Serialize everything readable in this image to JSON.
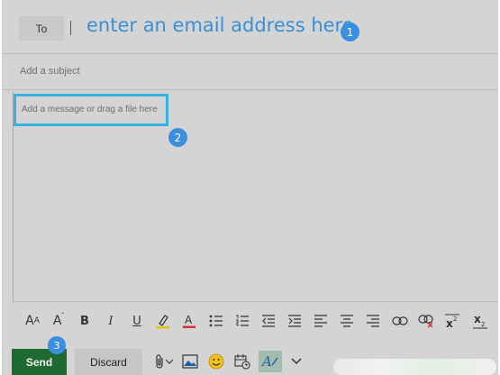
{
  "to": {
    "button_label": "To",
    "hint": "enter an email address here"
  },
  "subject": {
    "placeholder": "Add a subject"
  },
  "message": {
    "placeholder": "Add a message or drag a file here"
  },
  "badges": [
    "1",
    "2",
    "3"
  ],
  "toolbar": {
    "items": [
      "font-size-icon",
      "grow-font-icon",
      "bold-icon",
      "italic-icon",
      "underline-icon",
      "highlight-icon",
      "font-color-icon",
      "bullets-icon",
      "numbering-icon",
      "decrease-indent-icon",
      "increase-indent-icon",
      "align-left-icon",
      "align-center-icon",
      "align-right-icon",
      "link-icon",
      "remove-link-icon",
      "superscript-icon",
      "subscript-icon"
    ]
  },
  "actions": {
    "send_label": "Send",
    "discard_label": "Discard"
  },
  "colors": {
    "accent_blue": "#3a8fd6",
    "badge_blue": "#3b8fe0",
    "highlight_border": "#38b0e0",
    "send_green": "#1e6a33",
    "background": "#d4d4d4"
  }
}
